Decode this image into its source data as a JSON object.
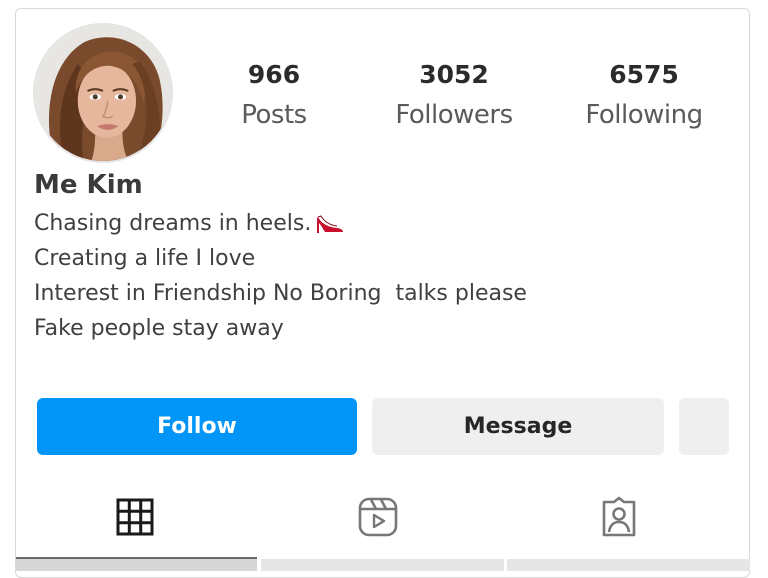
{
  "profile": {
    "name": "Me Kim",
    "avatar": "profile-photo"
  },
  "stats": {
    "posts": {
      "value": "966",
      "label": "Posts"
    },
    "followers": {
      "value": "3052",
      "label": "Followers"
    },
    "following": {
      "value": "6575",
      "label": "Following"
    }
  },
  "bio": {
    "lines": [
      "Chasing dreams in heels.",
      "Creating a life I love",
      "Interest in Friendship No Boring  talks please",
      "Fake people stay away"
    ],
    "emoji": "high-heel-icon"
  },
  "actions": {
    "follow_label": "Follow",
    "message_label": "Message",
    "more": "suggested-users-icon"
  },
  "tabs": [
    {
      "icon": "grid-icon",
      "active": true
    },
    {
      "icon": "reels-icon",
      "active": false
    },
    {
      "icon": "tagged-icon",
      "active": false
    }
  ],
  "colors": {
    "accent": "#0095f6",
    "secondary_button": "#efefef",
    "heel": "#c8102e"
  }
}
